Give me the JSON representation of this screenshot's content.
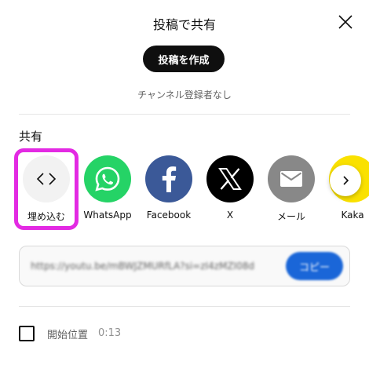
{
  "dialog": {
    "title": "投稿で共有",
    "create_post_label": "投稿を作成",
    "subscribers_text": "チャンネル登録者なし"
  },
  "share": {
    "title": "共有",
    "items": [
      {
        "label": "埋め込む",
        "icon": "embed-code-icon",
        "color": "#f2f2f2"
      },
      {
        "label": "WhatsApp",
        "icon": "whatsapp-icon",
        "color": "#25d366"
      },
      {
        "label": "Facebook",
        "icon": "facebook-icon",
        "color": "#3b5998"
      },
      {
        "label": "X",
        "icon": "x-icon",
        "color": "#000000"
      },
      {
        "label": "メール",
        "icon": "mail-icon",
        "color": "#888888"
      },
      {
        "label": "Kaka",
        "icon": "kakaotalk-icon",
        "color": "#fae100"
      }
    ],
    "highlight_color": "#e32ae3"
  },
  "link": {
    "url": "https://youtu.be/mBWJZMURfLA?si=zI4zMZI08d",
    "copy_label": "コピー",
    "copy_color": "#1a66d8"
  },
  "start_at": {
    "label": "開始位置",
    "time": "0:13",
    "checked": false
  }
}
